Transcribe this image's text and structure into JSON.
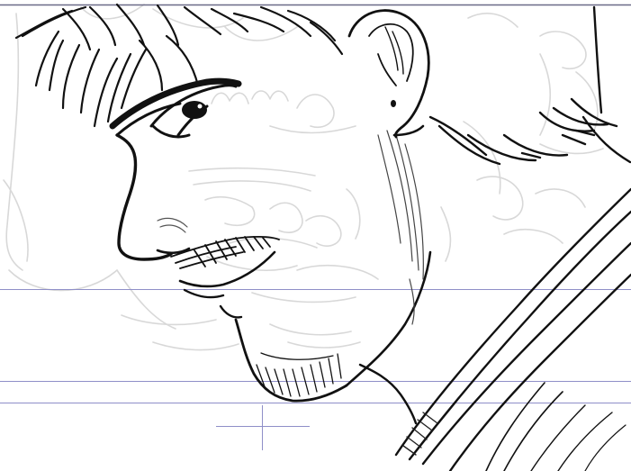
{
  "canvas": {
    "background": "#ffffff",
    "guide_color": "#8f8fc8",
    "top_border_color": "#6b6b88",
    "sketch_color": "#d8d8d8",
    "ink_color": "#111111",
    "shade_color": "#555555",
    "ui_text": []
  }
}
